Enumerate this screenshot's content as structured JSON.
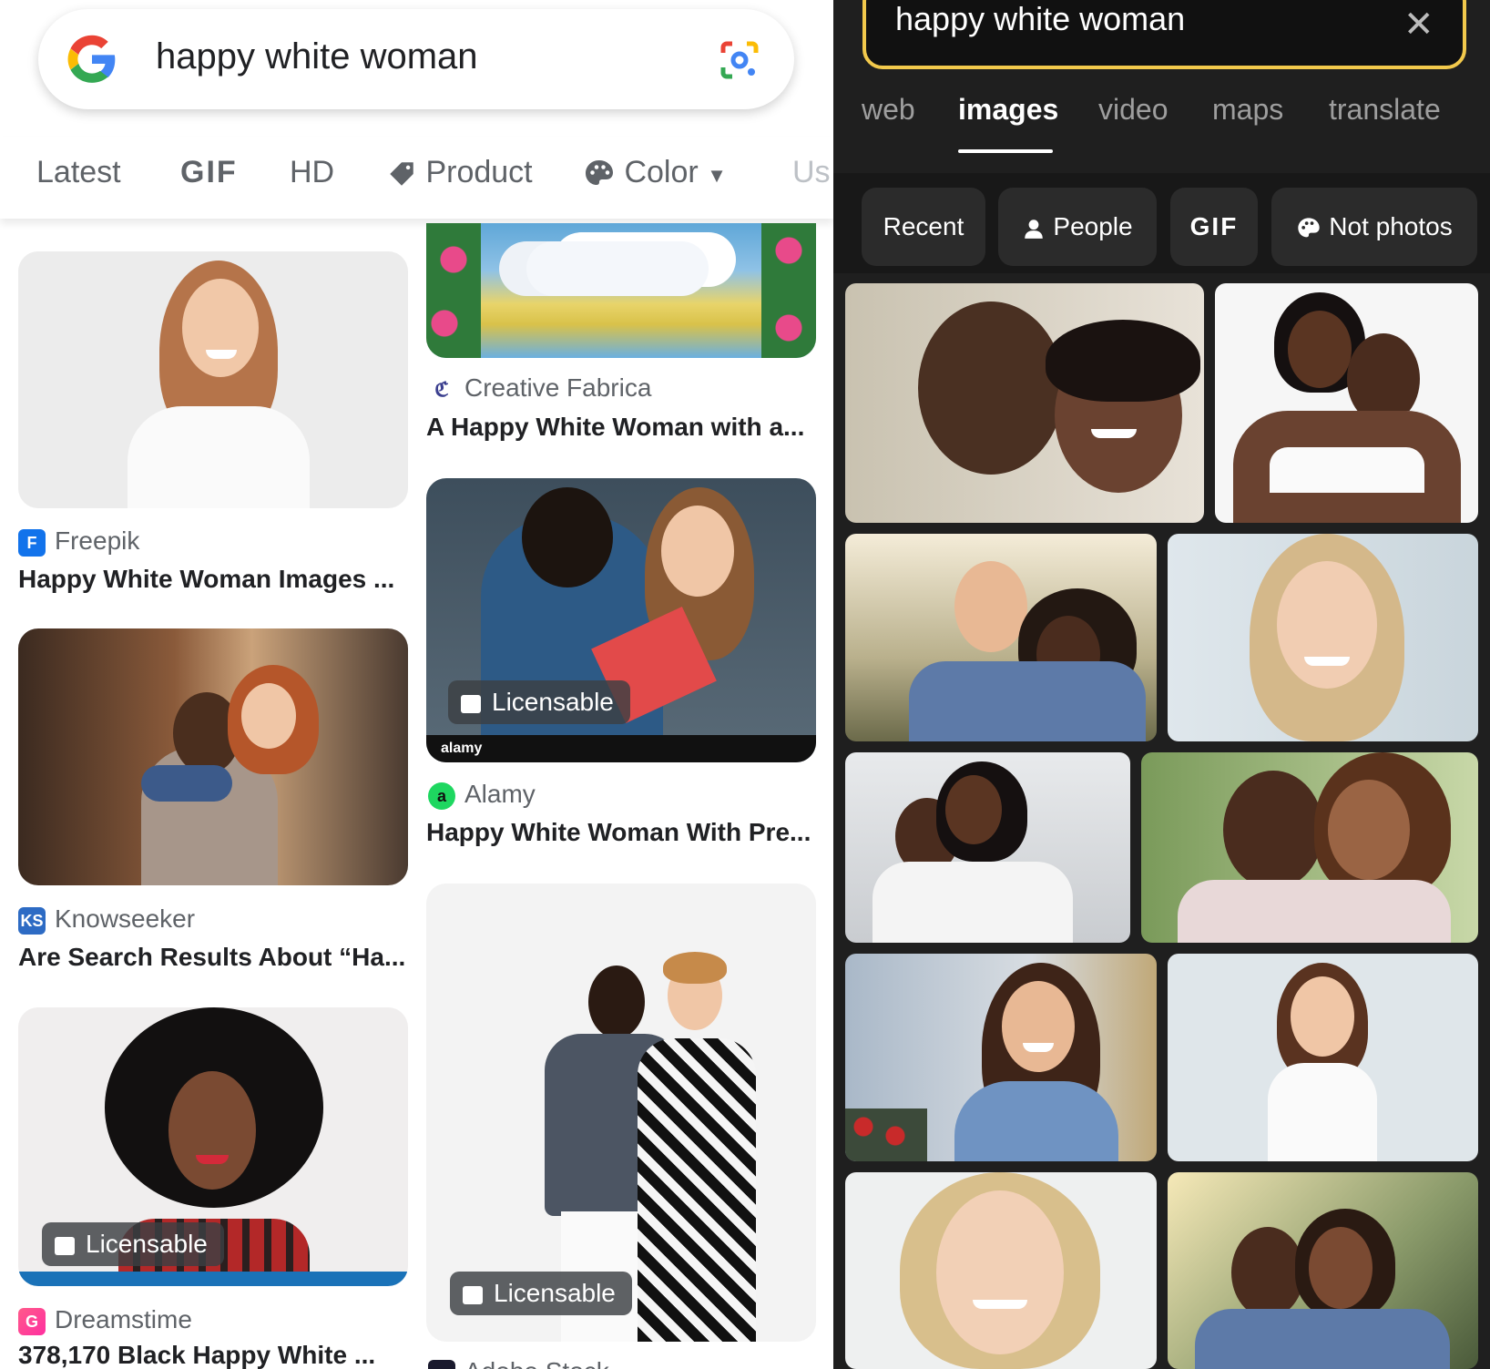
{
  "left": {
    "search": {
      "query": "happy white woman"
    },
    "filters": [
      "Latest",
      "GIF",
      "HD",
      "Product",
      "Color",
      "Us"
    ],
    "results": [
      {
        "source": "Creative Fabrica",
        "title": "A Happy White Woman with a..."
      },
      {
        "source": "Freepik",
        "title": "Happy White Woman Images ..."
      },
      {
        "source": "Alamy",
        "title": "Happy White Woman With Pre...",
        "badge": "Licensable"
      },
      {
        "source": "Knowseeker",
        "title": "Are Search Results About “Ha..."
      },
      {
        "source": "Dreamstime",
        "title": "378,170 Black Happy White ...",
        "badge": "Licensable"
      },
      {
        "source": "Adobe Stock",
        "title": "",
        "badge": "Licensable"
      }
    ],
    "source_icon_letters": {
      "knowseeker": "KS",
      "alamy": "a"
    },
    "watermark": "alamy"
  },
  "right": {
    "search": {
      "query": "happy white woman",
      "close": "✕"
    },
    "tabs": [
      "web",
      "images",
      "video",
      "maps",
      "translate"
    ],
    "active_tab": "images",
    "chips": [
      "Recent",
      "People",
      "GIF",
      "Not photos"
    ]
  },
  "colors": {
    "accent_yellow": "#f2c94c",
    "dark_bg": "#1f1f1f"
  }
}
